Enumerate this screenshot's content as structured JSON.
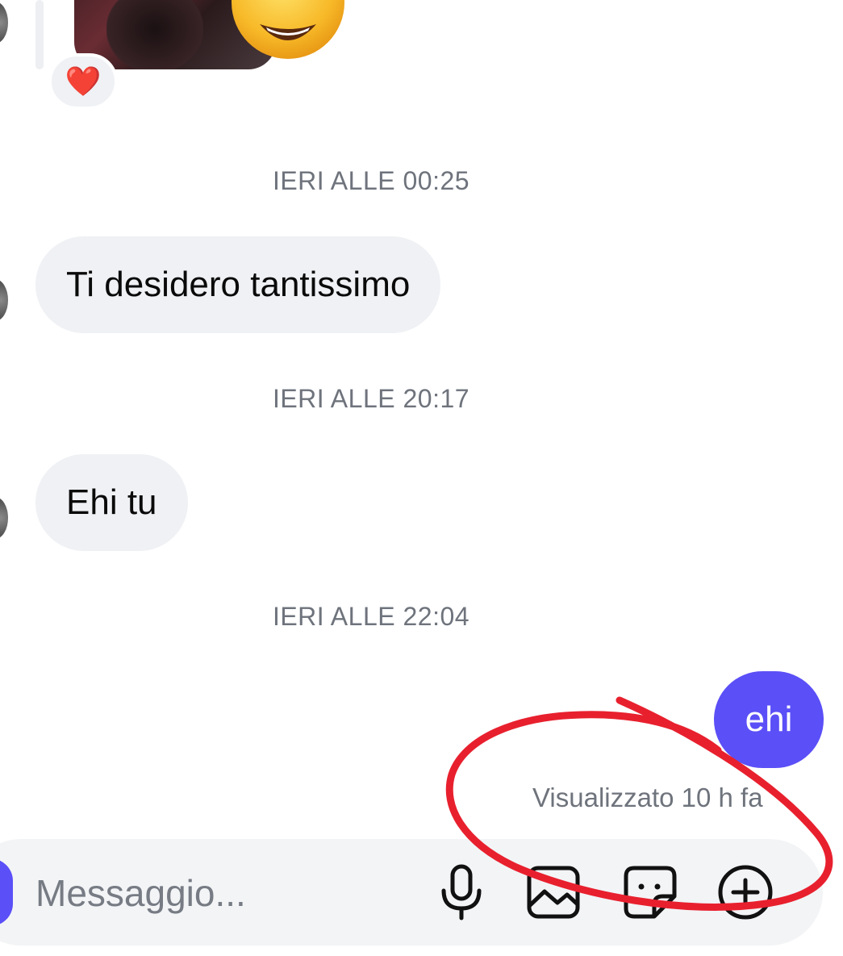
{
  "conversation": {
    "reaction_emoji": "❤️",
    "messages": [
      {
        "timestamp": "IERI ALLE 00:25",
        "text": "Ti desidero tantissimo",
        "direction": "incoming"
      },
      {
        "timestamp": "IERI ALLE 20:17",
        "text": "Ehi tu",
        "direction": "incoming"
      },
      {
        "timestamp": "IERI ALLE 22:04",
        "text": "ehi",
        "direction": "outgoing"
      }
    ],
    "seen_status": "Visualizzato 10 h fa"
  },
  "composer": {
    "placeholder": "Messaggio...",
    "icons": [
      "microphone-icon",
      "gallery-icon",
      "sticker-icon",
      "add-circle-icon"
    ]
  },
  "colors": {
    "outgoing_bubble": "#5b4ff7",
    "incoming_bubble": "#eff1f4",
    "timestamp_text": "#6e737c",
    "annotation_stroke": "#e8202e"
  }
}
